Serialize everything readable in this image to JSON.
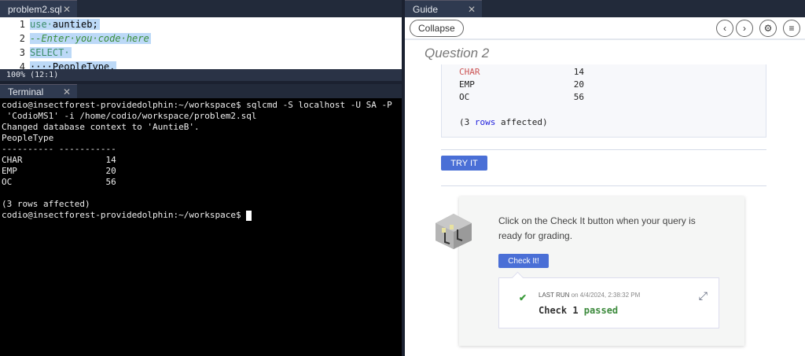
{
  "editor": {
    "tab_label": "problem2.sql",
    "lines": [
      {
        "n": "1",
        "kw": "use·",
        "rest": "auntieb;"
      },
      {
        "n": "2",
        "comment": "--Enter·you·code·here"
      },
      {
        "n": "3",
        "kw": "SELECT·",
        "rest": ""
      },
      {
        "n": "4",
        "kw": "",
        "rest": "····PeopleType,"
      }
    ],
    "status": "100%  (12:1)"
  },
  "terminal": {
    "tab_label": "Terminal",
    "output": "codio@insectforest-providedolphin:~/workspace$ sqlcmd -S localhost -U SA -P\n 'CodioMS1' -i /home/codio/workspace/problem2.sql\nChanged database context to 'AuntieB'.\nPeopleType\n---------- -----------\nCHAR                14\nEMP                 20\nOC                  56\n\n(3 rows affected)\ncodio@insectforest-providedolphin:~/workspace$ "
  },
  "guide": {
    "tab_label": "Guide",
    "collapse_label": "Collapse",
    "question_title": "Question 2",
    "code_rows": [
      {
        "name": "CHAR",
        "value": "14"
      },
      {
        "name": "EMP",
        "value": "20"
      },
      {
        "name": "OC",
        "value": "56"
      }
    ],
    "rows_affected": {
      "pre": "(3 ",
      "kw": "rows",
      "post": " affected)"
    },
    "try_it_label": "TRY IT",
    "card_text": "Click on the Check It button when your query is ready for grading.",
    "check_it_label": "Check It!",
    "last_run_label": "LAST RUN",
    "last_run_time": " on 4/4/2024, 2:38:32 PM",
    "check_text": "Check 1 ",
    "check_status": "passed"
  },
  "colors": {
    "accent": "#4a6fd6",
    "passed": "#3d8b3d",
    "terminal_bg": "#000000"
  }
}
